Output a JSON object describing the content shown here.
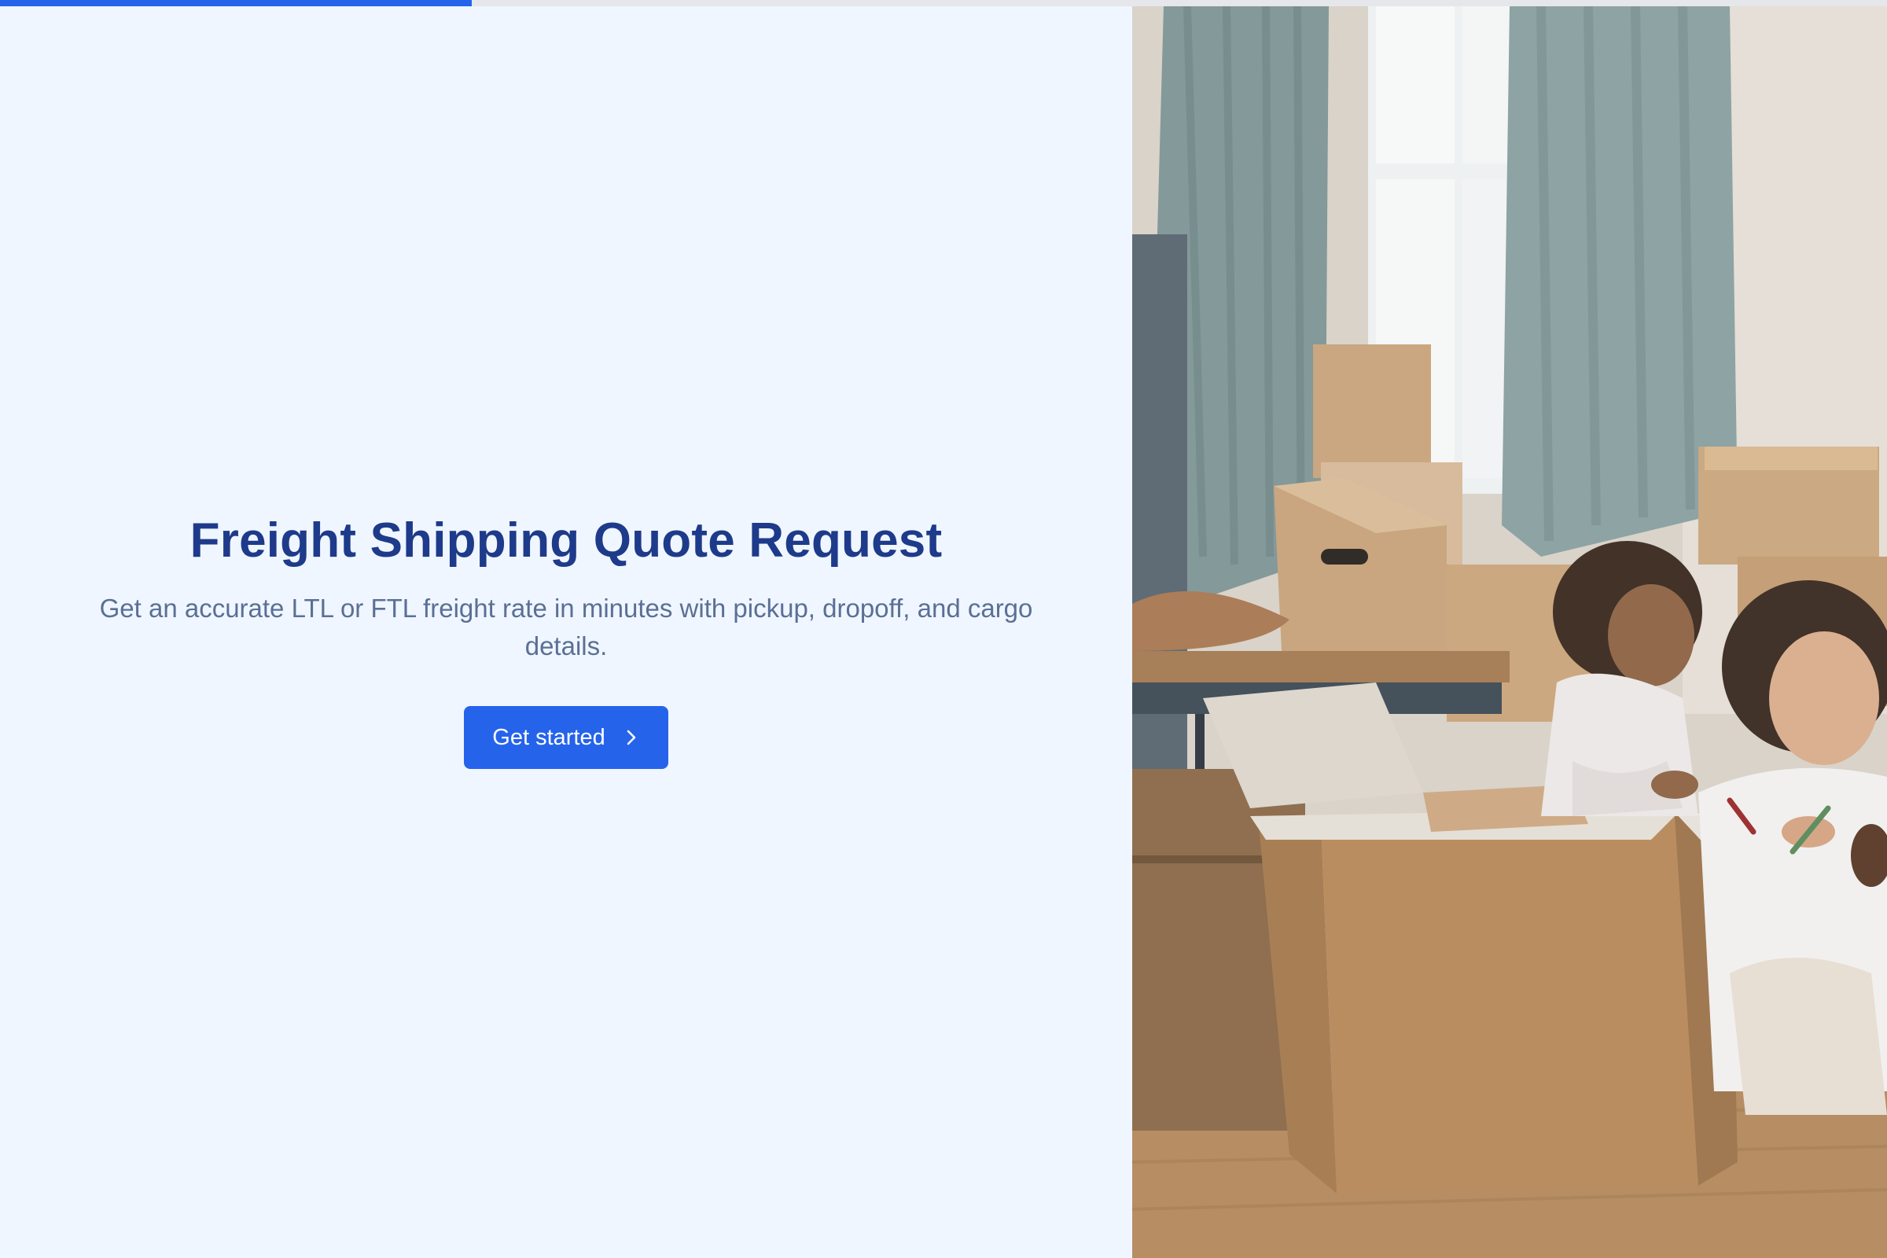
{
  "progress": {
    "value_fraction": 0.25,
    "color": "#2563eb"
  },
  "hero": {
    "title": "Freight Shipping Quote Request",
    "subtitle": "Get an accurate LTL or FTL freight rate in minutes with pickup, dropoff, and cargo details.",
    "cta_label": "Get started",
    "cta_icon": "chevron-right-icon"
  },
  "colors": {
    "background": "#eff6ff",
    "title": "#1e3a8a",
    "subtitle": "#5b6f96",
    "button": "#2563eb"
  }
}
